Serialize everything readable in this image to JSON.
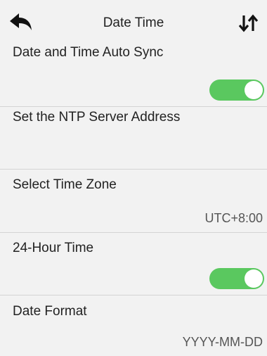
{
  "header": {
    "title": "Date Time",
    "back_icon": "back-arrow-icon",
    "sort_icon": "up-down-arrows-icon"
  },
  "settings": [
    {
      "label": "Date and Time Auto Sync",
      "control": "toggle",
      "on": true
    },
    {
      "label": "Set the NTP Server Address",
      "value": ""
    },
    {
      "label": "Select Time Zone",
      "value": "UTC+8:00"
    },
    {
      "label": "24-Hour Time",
      "control": "toggle",
      "on": true
    },
    {
      "label": "Date Format",
      "value": "YYYY-MM-DD"
    }
  ],
  "colors": {
    "toggle_on": "#5ac85f",
    "background": "#f2f2f2",
    "divider": "#d4d4d4"
  }
}
